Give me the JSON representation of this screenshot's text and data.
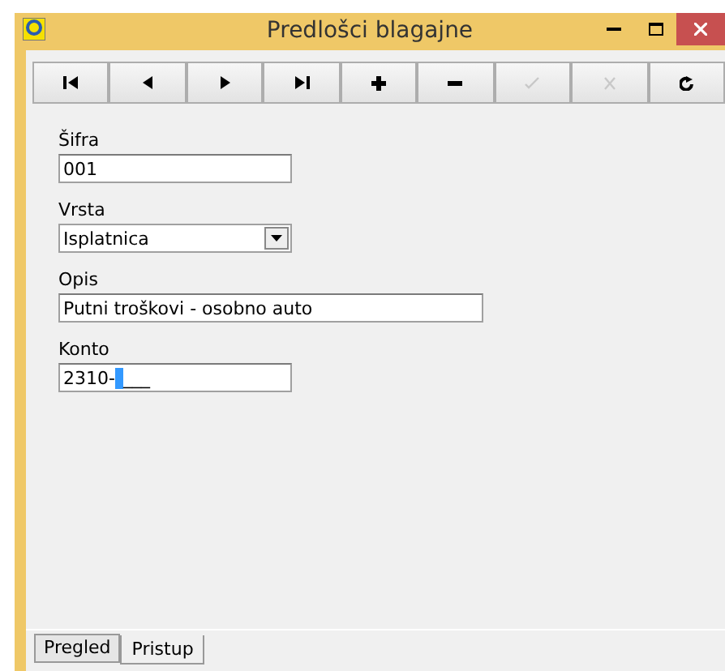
{
  "window": {
    "title": "Predlošci blagajne"
  },
  "toolbar": [
    {
      "kind": "first",
      "disabled": false
    },
    {
      "kind": "prev",
      "disabled": false
    },
    {
      "kind": "next",
      "disabled": false
    },
    {
      "kind": "last",
      "disabled": false
    },
    {
      "kind": "add",
      "disabled": false
    },
    {
      "kind": "remove",
      "disabled": false
    },
    {
      "kind": "confirm",
      "disabled": true
    },
    {
      "kind": "cancel",
      "disabled": true
    },
    {
      "kind": "refresh",
      "disabled": false
    }
  ],
  "fields": [
    {
      "kind": "text",
      "label": "Šifra",
      "value": "001",
      "wide": false
    },
    {
      "kind": "select",
      "label": "Vrsta",
      "value": "Isplatnica",
      "wide": false
    },
    {
      "kind": "text",
      "label": "Opis",
      "value": "Putni troškovi - osobno auto",
      "wide": true
    },
    {
      "kind": "masked",
      "label": "Konto",
      "value": "2310-",
      "mask": "___",
      "wide": false
    }
  ],
  "tabs": [
    {
      "label": "Pregled",
      "selected": false
    },
    {
      "label": "Pristup",
      "selected": true
    }
  ]
}
